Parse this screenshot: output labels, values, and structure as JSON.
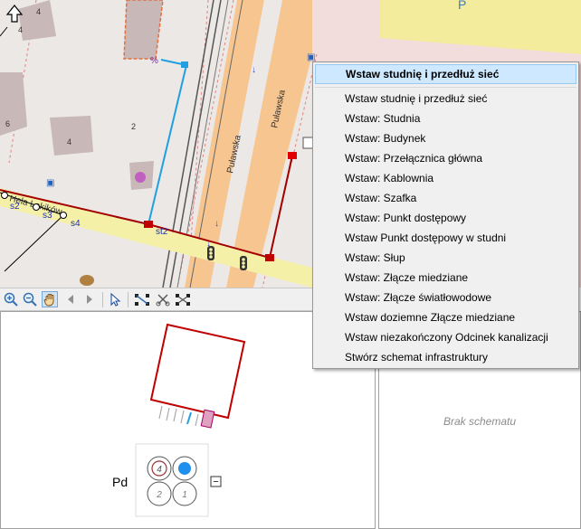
{
  "map": {
    "street_labels": [
      "Puławska",
      "Puławska",
      "Hela Lokików"
    ],
    "segment_labels": [
      "s2",
      "s3",
      "s4",
      "st2"
    ],
    "building_numbers": [
      "4",
      "6",
      "2",
      "4",
      "4",
      "4"
    ],
    "parking_label": "P"
  },
  "toolbar": {
    "tools": [
      "zoom-in",
      "zoom-out",
      "pan",
      "back",
      "forward",
      "select",
      "connect",
      "cut",
      "split"
    ]
  },
  "context_menu": {
    "header": "Wstaw studnię i przedłuż sieć",
    "items": [
      "Wstaw studnię i przedłuż sieć",
      "Wstaw: Studnia",
      "Wstaw: Budynek",
      "Wstaw: Przełącznica główna",
      "Wstaw: Kablownia",
      "Wstaw: Szafka",
      "Wstaw: Punkt dostępowy",
      "Wstaw Punkt dostępowy w studni",
      "Wstaw: Słup",
      "Wstaw: Złącze miedziane",
      "Wstaw: Złącze światłowodowe",
      "Wstaw doziemne Złącze miedziane",
      "Wstaw niezakończony Odcinek kanalizacji",
      "Stwórz schemat infrastruktury"
    ]
  },
  "schema_panel": {
    "label": "Pd",
    "ducts": [
      "4",
      "",
      "2",
      "1"
    ],
    "collapse_symbol": "−"
  },
  "right_panel": {
    "empty_text": "Brak schematu"
  },
  "colors": {
    "road": "#f7c590",
    "highlight_road": "#f5f0a8",
    "building": "#c9b8b8",
    "line_red": "#a30000",
    "line_blue": "#20a0e0",
    "menu_highlight": "#cde8ff"
  }
}
